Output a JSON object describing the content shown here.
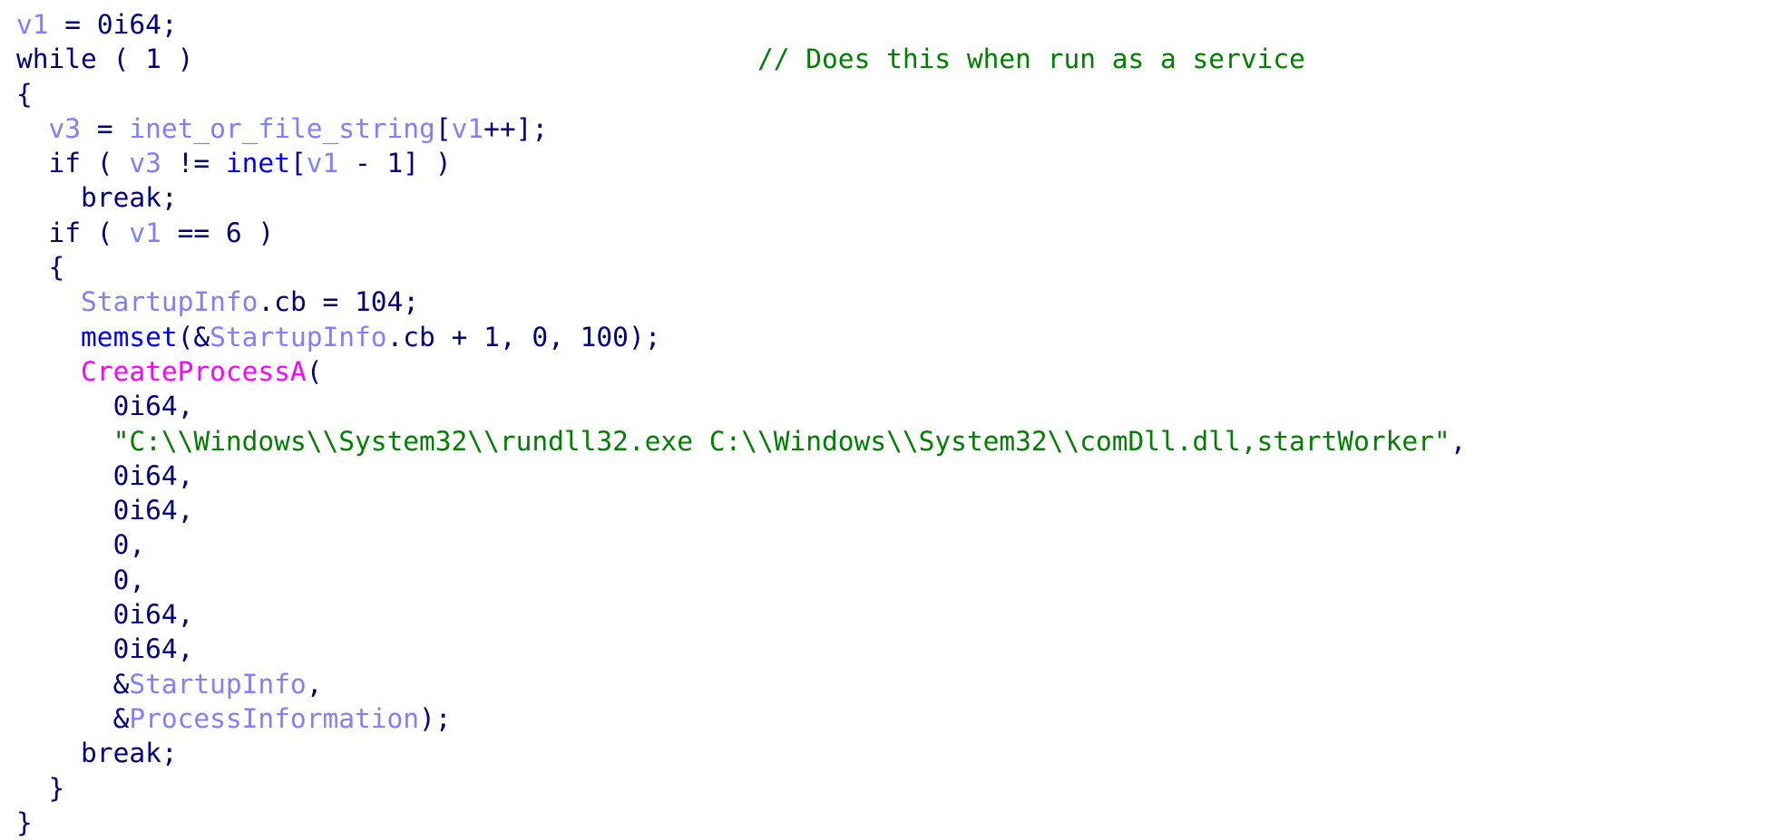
{
  "view": "decompiled pseudocode",
  "colors": {
    "variable": "#8080ff",
    "default": "#000080",
    "function": "#0000ff",
    "import_api": "#ff00ff",
    "string": "#008000",
    "comment": "#008000"
  },
  "lines": [
    [
      {
        "t": "var",
        "s": "v1"
      },
      {
        "t": "punct",
        "s": " = 0i64;"
      }
    ],
    [
      {
        "t": "kw",
        "s": "while ( 1 )"
      },
      {
        "t": "punct",
        "s": "                                   "
      },
      {
        "t": "cmt",
        "s": "// Does this when run as a service"
      }
    ],
    [
      {
        "t": "punct",
        "s": "{"
      }
    ],
    [
      {
        "t": "punct",
        "s": "  "
      },
      {
        "t": "var",
        "s": "v3"
      },
      {
        "t": "punct",
        "s": " = "
      },
      {
        "t": "var",
        "s": "inet_or_file_string"
      },
      {
        "t": "punct",
        "s": "["
      },
      {
        "t": "var",
        "s": "v1"
      },
      {
        "t": "punct",
        "s": "++];"
      }
    ],
    [
      {
        "t": "punct",
        "s": "  if ( "
      },
      {
        "t": "var",
        "s": "v3"
      },
      {
        "t": "punct",
        "s": " != "
      },
      {
        "t": "fn",
        "s": "inet"
      },
      {
        "t": "punct",
        "s": "["
      },
      {
        "t": "var",
        "s": "v1"
      },
      {
        "t": "punct",
        "s": " - 1] )"
      }
    ],
    [
      {
        "t": "punct",
        "s": "    break;"
      }
    ],
    [
      {
        "t": "punct",
        "s": "  if ( "
      },
      {
        "t": "var",
        "s": "v1"
      },
      {
        "t": "punct",
        "s": " == 6 )"
      }
    ],
    [
      {
        "t": "punct",
        "s": "  {"
      }
    ],
    [
      {
        "t": "punct",
        "s": "    "
      },
      {
        "t": "var",
        "s": "StartupInfo"
      },
      {
        "t": "punct",
        "s": ".cb = 104;"
      }
    ],
    [
      {
        "t": "punct",
        "s": "    "
      },
      {
        "t": "fn",
        "s": "memset"
      },
      {
        "t": "punct",
        "s": "(&"
      },
      {
        "t": "var",
        "s": "StartupInfo"
      },
      {
        "t": "punct",
        "s": ".cb + 1, 0, 100);"
      }
    ],
    [
      {
        "t": "punct",
        "s": "    "
      },
      {
        "t": "api",
        "s": "CreateProcessA"
      },
      {
        "t": "punct",
        "s": "("
      }
    ],
    [
      {
        "t": "punct",
        "s": "      0i64,"
      }
    ],
    [
      {
        "t": "punct",
        "s": "      "
      },
      {
        "t": "str",
        "s": "\"C:\\\\Windows\\\\System32\\\\rundll32.exe C:\\\\Windows\\\\System32\\\\comDll.dll,startWorker\""
      },
      {
        "t": "punct",
        "s": ","
      }
    ],
    [
      {
        "t": "punct",
        "s": "      0i64,"
      }
    ],
    [
      {
        "t": "punct",
        "s": "      0i64,"
      }
    ],
    [
      {
        "t": "punct",
        "s": "      0,"
      }
    ],
    [
      {
        "t": "punct",
        "s": "      0,"
      }
    ],
    [
      {
        "t": "punct",
        "s": "      0i64,"
      }
    ],
    [
      {
        "t": "punct",
        "s": "      0i64,"
      }
    ],
    [
      {
        "t": "punct",
        "s": "      &"
      },
      {
        "t": "var",
        "s": "StartupInfo"
      },
      {
        "t": "punct",
        "s": ","
      }
    ],
    [
      {
        "t": "punct",
        "s": "      &"
      },
      {
        "t": "var",
        "s": "ProcessInformation"
      },
      {
        "t": "punct",
        "s": ");"
      }
    ],
    [
      {
        "t": "punct",
        "s": "    break;"
      }
    ],
    [
      {
        "t": "punct",
        "s": "  }"
      }
    ],
    [
      {
        "t": "punct",
        "s": "}"
      }
    ]
  ]
}
